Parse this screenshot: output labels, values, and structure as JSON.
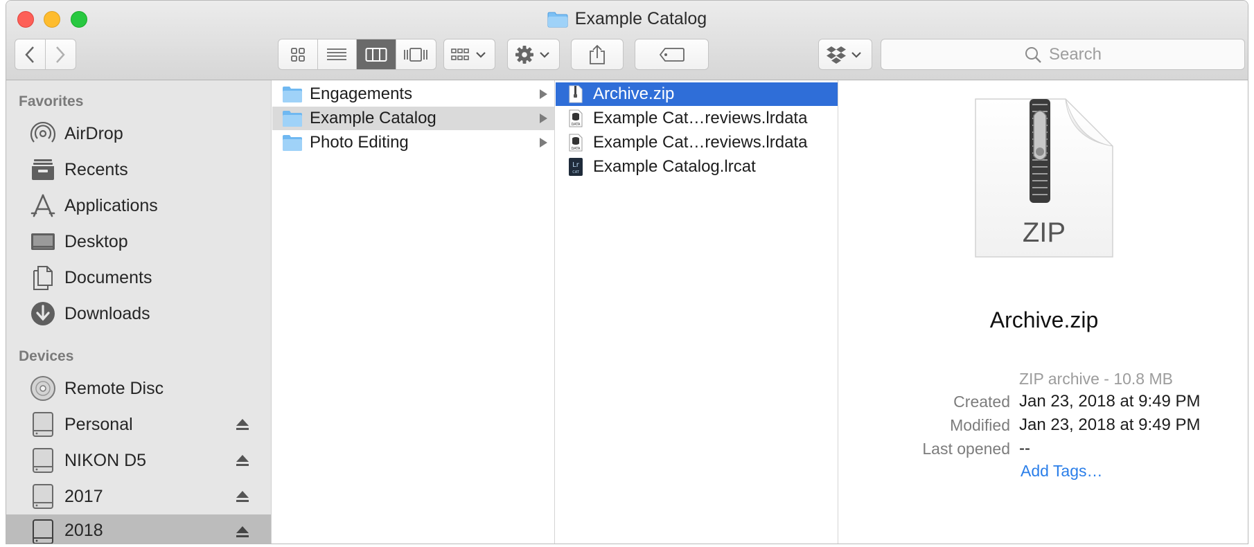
{
  "window": {
    "title": "Example Catalog"
  },
  "toolbar": {
    "search_placeholder": "Search",
    "icons": [
      "chevron-left-icon",
      "chevron-right-icon",
      "icon-view-icon",
      "list-view-icon",
      "column-view-icon",
      "gallery-view-icon",
      "group-icon",
      "gear-icon",
      "share-icon",
      "tag-icon",
      "dropbox-icon",
      "search-icon"
    ],
    "active_view": "column"
  },
  "sidebar": {
    "favorites_header": "Favorites",
    "favorites": [
      {
        "label": "AirDrop",
        "icon": "airdrop-icon"
      },
      {
        "label": "Recents",
        "icon": "recents-icon"
      },
      {
        "label": "Applications",
        "icon": "applications-icon"
      },
      {
        "label": "Desktop",
        "icon": "desktop-icon"
      },
      {
        "label": "Documents",
        "icon": "documents-icon"
      },
      {
        "label": "Downloads",
        "icon": "downloads-icon"
      }
    ],
    "devices_header": "Devices",
    "devices": [
      {
        "label": "Remote Disc",
        "icon": "disc-icon",
        "eject": false
      },
      {
        "label": "Personal",
        "icon": "drive-icon",
        "eject": true
      },
      {
        "label": "NIKON D5",
        "icon": "drive-icon",
        "eject": true
      },
      {
        "label": "2017",
        "icon": "drive-icon",
        "eject": true
      },
      {
        "label": "2018",
        "icon": "drive-icon",
        "eject": true,
        "selected": true
      }
    ]
  },
  "column1": {
    "items": [
      {
        "label": "Engagements",
        "icon": "folder-icon"
      },
      {
        "label": "Example Catalog",
        "icon": "folder-icon",
        "selected": true
      },
      {
        "label": "Photo Editing",
        "icon": "folder-icon"
      }
    ]
  },
  "column2": {
    "items": [
      {
        "label": "Archive.zip",
        "icon": "zip-file-icon",
        "selected": true
      },
      {
        "label": "Example Cat…reviews.lrdata",
        "icon": "data-file-icon"
      },
      {
        "label": "Example Cat…reviews.lrdata",
        "icon": "data-file-icon"
      },
      {
        "label": "Example Catalog.lrcat",
        "icon": "lrcat-file-icon",
        "badge_top": "Lr",
        "badge_bottom": "CAT"
      }
    ],
    "data_badge": "DATA"
  },
  "preview": {
    "type_label": "ZIP",
    "name": "Archive.zip",
    "kind": "ZIP archive - 10.8 MB",
    "created_label": "Created",
    "created_value": "Jan 23, 2018 at 9:49 PM",
    "modified_label": "Modified",
    "modified_value": "Jan 23, 2018 at 9:49 PM",
    "opened_label": "Last opened",
    "opened_value": "--",
    "add_tags": "Add Tags…"
  },
  "colors": {
    "selection_blue": "#2f6ed8",
    "link_blue": "#2a7ee9",
    "folder_blue": "#6fb8f1"
  }
}
